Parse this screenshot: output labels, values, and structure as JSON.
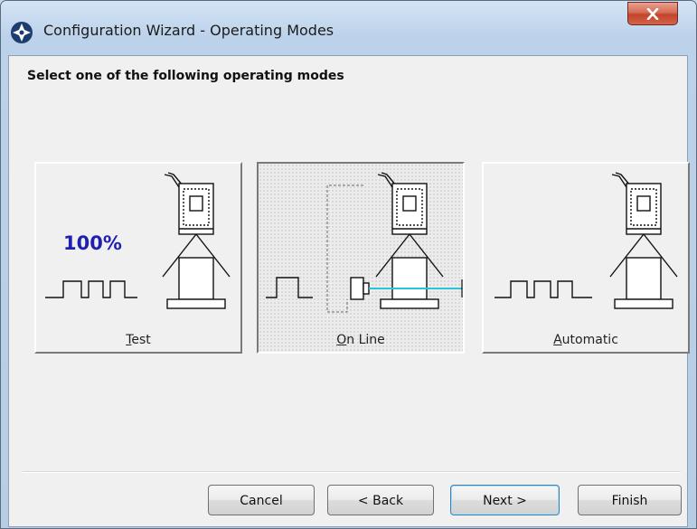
{
  "window": {
    "title": "Configuration Wizard - Operating Modes"
  },
  "main": {
    "heading": "Select one of the following operating modes",
    "modes": [
      {
        "label": "Test",
        "underline_char": "T",
        "rest": "est",
        "badge": "100%"
      },
      {
        "label": "On Line",
        "underline_char": "O",
        "rest": "n Line"
      },
      {
        "label": "Automatic",
        "underline_char": "A",
        "rest": "utomatic"
      }
    ],
    "selected_mode": "On Line"
  },
  "footer": {
    "cancel_label": "Cancel",
    "back_label": "< Back",
    "next_label": "Next >",
    "finish_label": "Finish"
  },
  "colors": {
    "badge": "#1f1fb2",
    "laser": "#29c4d6",
    "close_button": "#c84a31"
  },
  "icons": {
    "app": "crosshair-globe-icon",
    "close": "close-icon"
  }
}
